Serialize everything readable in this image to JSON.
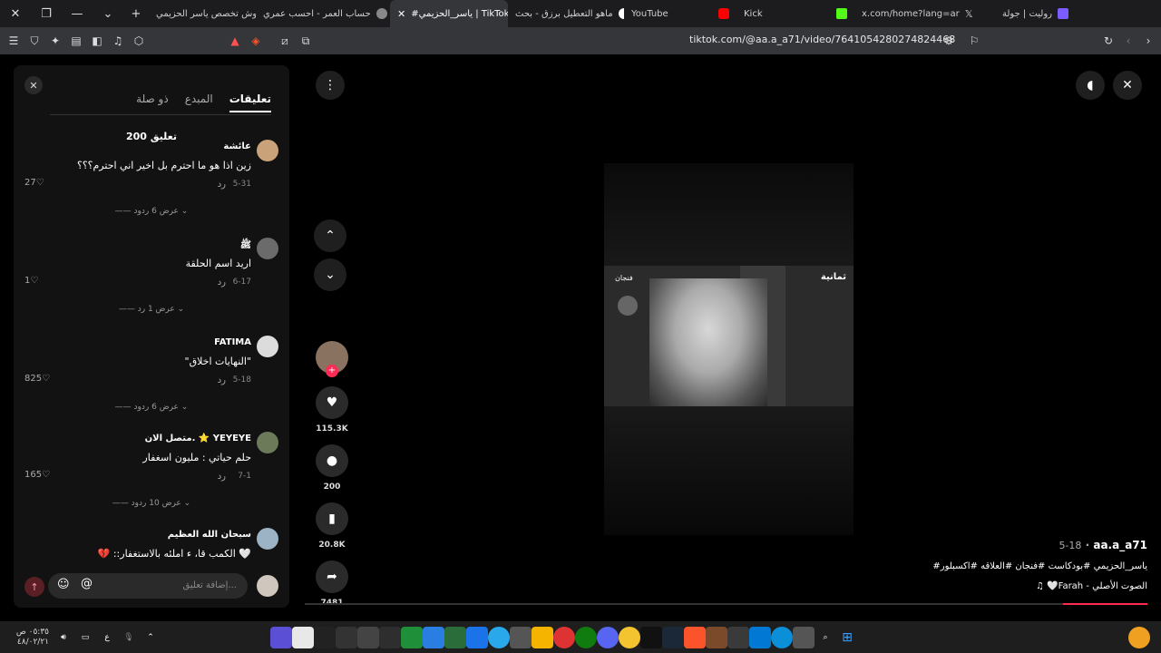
{
  "browser": {
    "tabs": [
      {
        "label": "روليت | جولة",
        "color": "#7b5cff"
      },
      {
        "label": "x.com/home?lang=ar",
        "color": "#000000"
      },
      {
        "label": "Kick",
        "color": "#53fc18"
      },
      {
        "label": "YouTube",
        "color": "#ff0000"
      },
      {
        "label": "ماهو التعطيل برزق - بحث",
        "color": "#ffffff"
      },
      {
        "label": "#ياسر_الحزيمي | TikTok",
        "color": "#111111"
      },
      {
        "label": "حساب العمر - احسب عمري",
        "color": "#888888"
      },
      {
        "label": "وش تخصص ياسر الحزيمي",
        "color": "#ffffff"
      }
    ],
    "url": "tiktok.com/@aa.a_a71/video/7641054280274824468"
  },
  "comments_panel": {
    "tabs": [
      "تعليقات",
      "المبدع",
      "ذو صلة"
    ],
    "count": "200 تعليق",
    "reply_label": "رد",
    "input_placeholder": "إضافة تعليق...",
    "comments": [
      {
        "name": "عائشة",
        "text": "زين اذا هو ما احترم بل اخير اني احترم؟؟؟",
        "date": "5-31",
        "likes": "27",
        "more": "عرض 6 ردود"
      },
      {
        "name": "ﷺ",
        "text": "اريد اسم الحلقة",
        "date": "6-17",
        "likes": "1",
        "more": "عرض 1 رد"
      },
      {
        "name": "FATIMA",
        "text": "\"النهايات اخلاق\"",
        "date": "5-18",
        "likes": "825",
        "more": "عرض 6 ردود"
      },
      {
        "name": "متصل الان. ⭐ 𝗬𝗘𝗬𝗘𝗬𝗘",
        "text": "حلم حياتي : مليون اسغفار",
        "date": "7-1",
        "likes": "165",
        "more": "عرض 10 ردود"
      },
      {
        "name": "سبحان الله العظيم",
        "text": "💔 ::الكمب قا، ء املئه بالاستغفار 🤍",
        "date": "",
        "likes": "",
        "more": ""
      }
    ]
  },
  "video": {
    "overlay_left": "فنجان",
    "overlay_right": "ثمانية",
    "author": "aa.a_a71",
    "date": "5-18",
    "caption": "#ياسر_الحزيمي #بودكاست #فنجان #العلاقه #اكسبلور",
    "sound": "♫ 🤍Farah - الصوت الأصلي",
    "progress_fraction": 0.1
  },
  "actions": {
    "likes": "115.3K",
    "comments": "200",
    "saves": "20.8K",
    "shares": "7481"
  },
  "taskbar": {
    "time": "٠٥:٣٥ ص",
    "date": "٤٨/٠٢/٢١",
    "lang": "ع"
  }
}
